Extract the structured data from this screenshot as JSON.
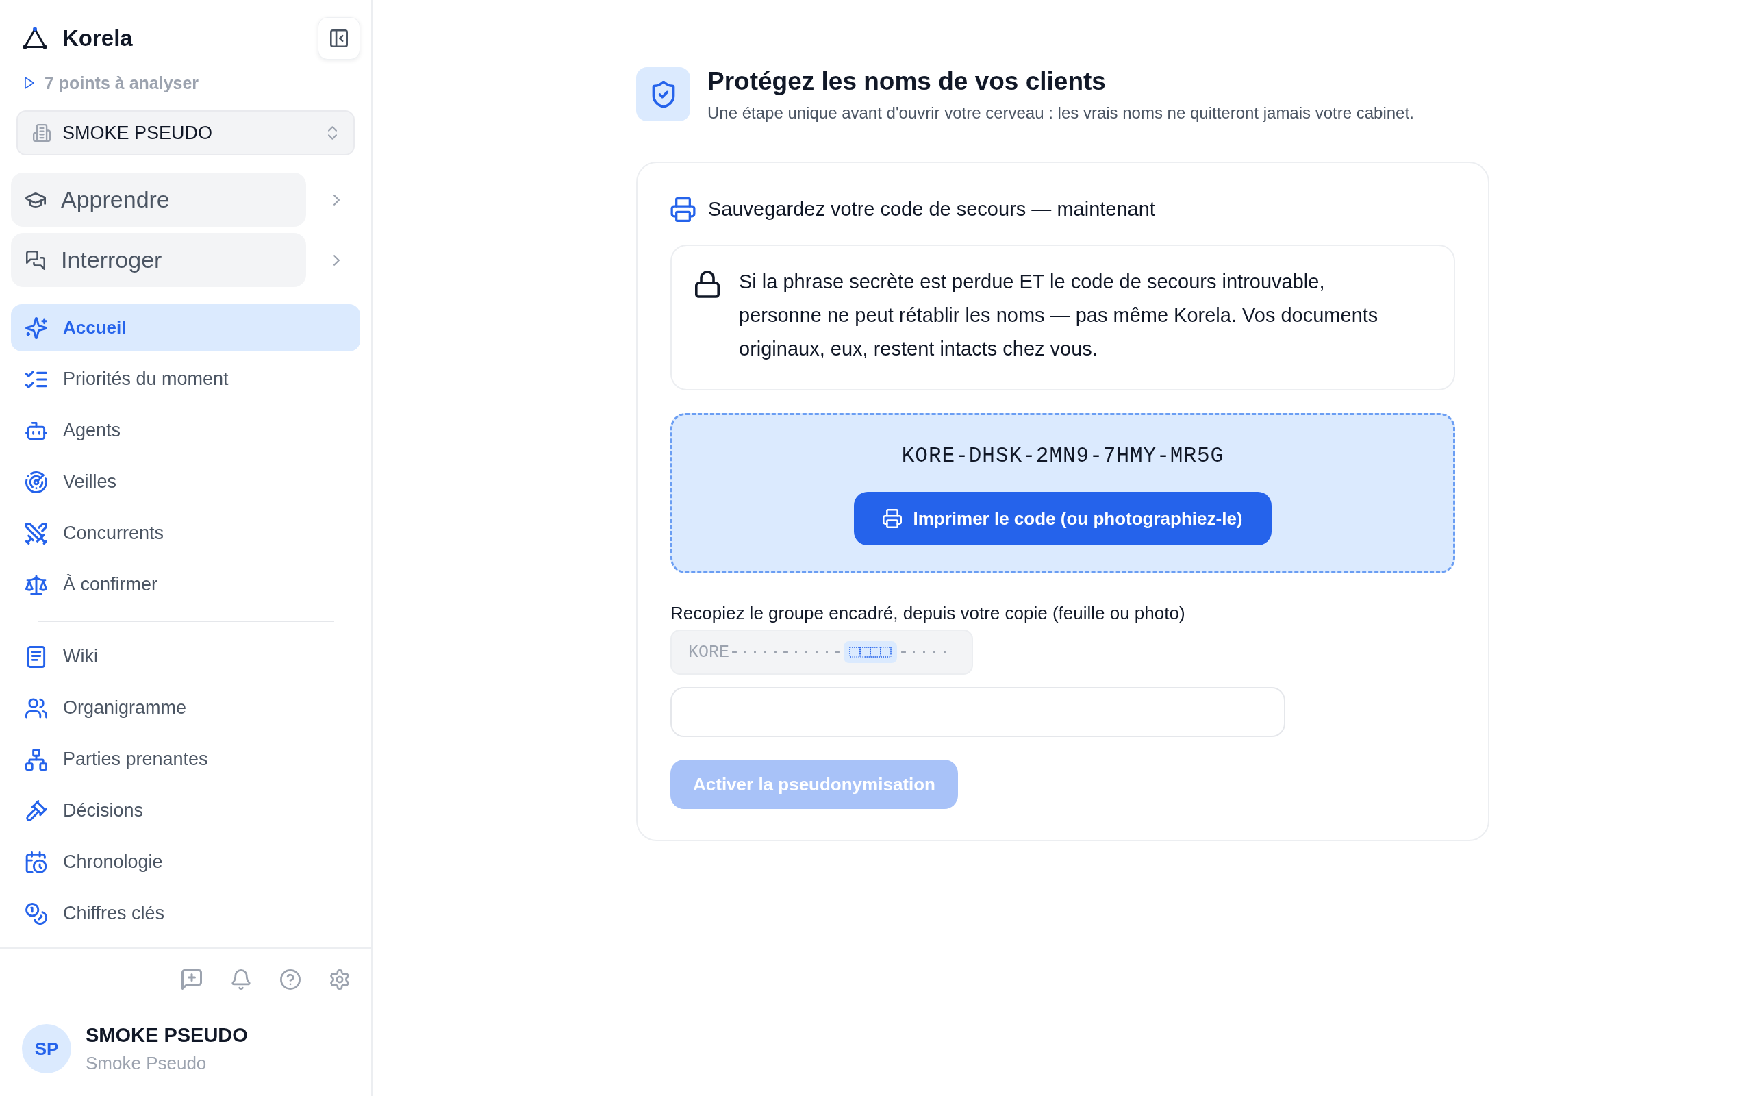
{
  "sidebar": {
    "brand": "Korela",
    "pending": "7 points à analyser",
    "workspace": "SMOKE PSEUDO",
    "sections": [
      {
        "label": "Apprendre",
        "expanded": false
      },
      {
        "label": "Interroger",
        "expanded": false
      }
    ],
    "nav_groups": [
      {
        "items": [
          {
            "label": "Accueil",
            "selected": true
          },
          {
            "label": "Priorités du moment",
            "selected": false
          },
          {
            "label": "Agents",
            "selected": false
          },
          {
            "label": "Veilles",
            "selected": false
          },
          {
            "label": "Concurrents",
            "selected": false
          },
          {
            "label": "À confirmer",
            "selected": false
          }
        ]
      },
      {
        "items": [
          {
            "label": "Wiki",
            "selected": false
          },
          {
            "label": "Organigramme",
            "selected": false
          },
          {
            "label": "Parties prenantes",
            "selected": false
          },
          {
            "label": "Décisions",
            "selected": false
          },
          {
            "label": "Chronologie",
            "selected": false
          },
          {
            "label": "Chiffres clés",
            "selected": false
          }
        ]
      }
    ],
    "user": {
      "initials": "SP",
      "name": "SMOKE PSEUDO",
      "subtitle": "Smoke Pseudo"
    }
  },
  "main": {
    "title": "Protégez les noms de vos clients",
    "subtitle": "Une étape unique avant d'ouvrir votre cerveau : les vrais noms ne quitteront jamais votre cabinet.",
    "card": {
      "heading": "Sauvegardez votre code de secours — maintenant",
      "warning": "Si la phrase secrète est perdue ET le code de secours introuvable, personne ne peut rétablir les noms — pas même Korela. Vos documents originaux, eux, restent intacts chez vous.",
      "recovery_code": "KORE-DHSK-2MN9-7HMY-MR5G",
      "print_button": "Imprimer le code (ou photographiez-le)",
      "copy_label": "Recopiez le groupe encadré, depuis votre copie (feuille ou photo)",
      "masked_code": {
        "before": "KORE-····-····-",
        "after": "-····"
      },
      "activate_button": {
        "label": "Activer la pseudonymisation",
        "disabled": true
      }
    }
  }
}
